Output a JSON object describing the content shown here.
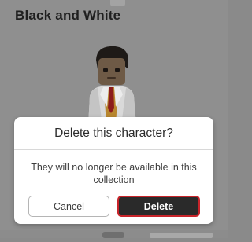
{
  "page": {
    "title": "Black and White"
  },
  "dialog": {
    "title": "Delete this character?",
    "message": "They will no longer be available in this collection",
    "cancel_label": "Cancel",
    "delete_label": "Delete"
  },
  "colors": {
    "overlay": "#8c8c8c",
    "dialog_bg": "#ffffff",
    "delete_bg": "#2a2a2a",
    "delete_border": "#c8242a"
  },
  "icons": {
    "avatar": "character-avatar"
  }
}
